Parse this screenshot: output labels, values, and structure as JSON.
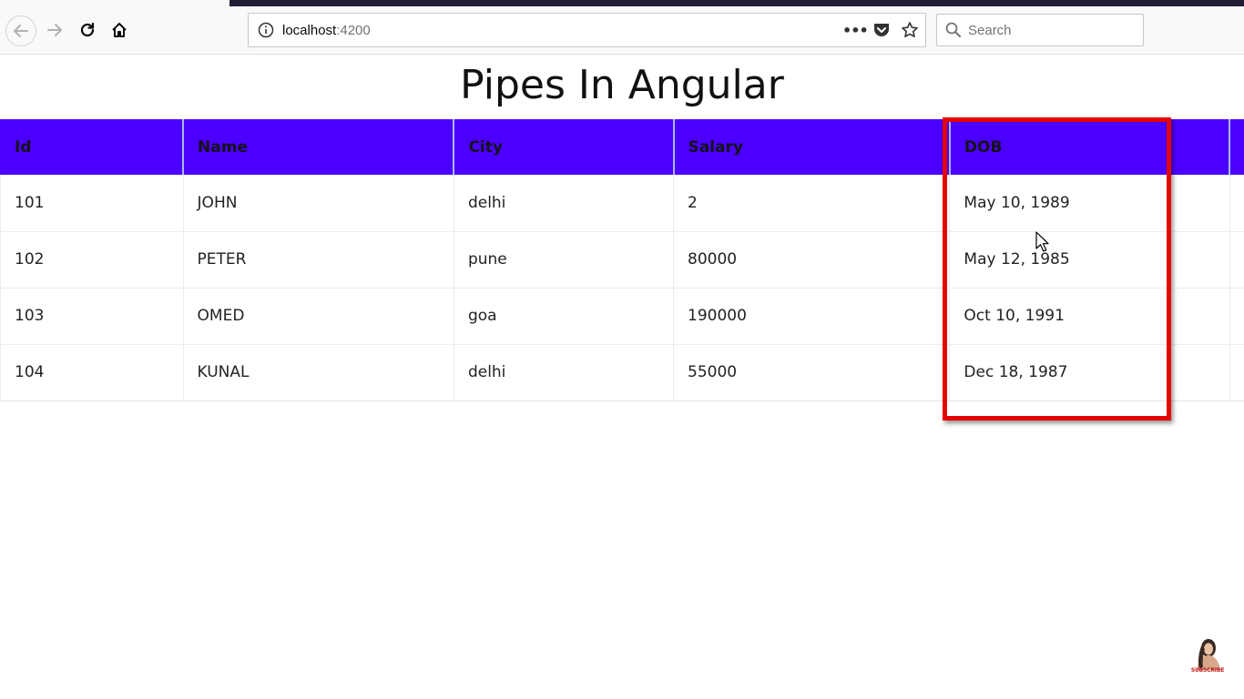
{
  "browser": {
    "url_host": "localhost",
    "url_port": ":4200",
    "search_placeholder": "Search",
    "more_label": "•••"
  },
  "page": {
    "title": "Pipes In Angular"
  },
  "table": {
    "headers": [
      "Id",
      "Name",
      "City",
      "Salary",
      "DOB"
    ],
    "rows": [
      [
        "101",
        "JOHN",
        "delhi",
        "2",
        "May 10, 1989"
      ],
      [
        "102",
        "PETER",
        "pune",
        "80000",
        "May 12, 1985"
      ],
      [
        "103",
        "OMED",
        "goa",
        "190000",
        "Oct 10, 1991"
      ],
      [
        "104",
        "KUNAL",
        "delhi",
        "55000",
        "Dec 18, 1987"
      ]
    ]
  },
  "watermark": {
    "label": "SUBSCRIBE"
  },
  "colors": {
    "header_bg": "#4c00ff",
    "highlight": "#e60000"
  }
}
